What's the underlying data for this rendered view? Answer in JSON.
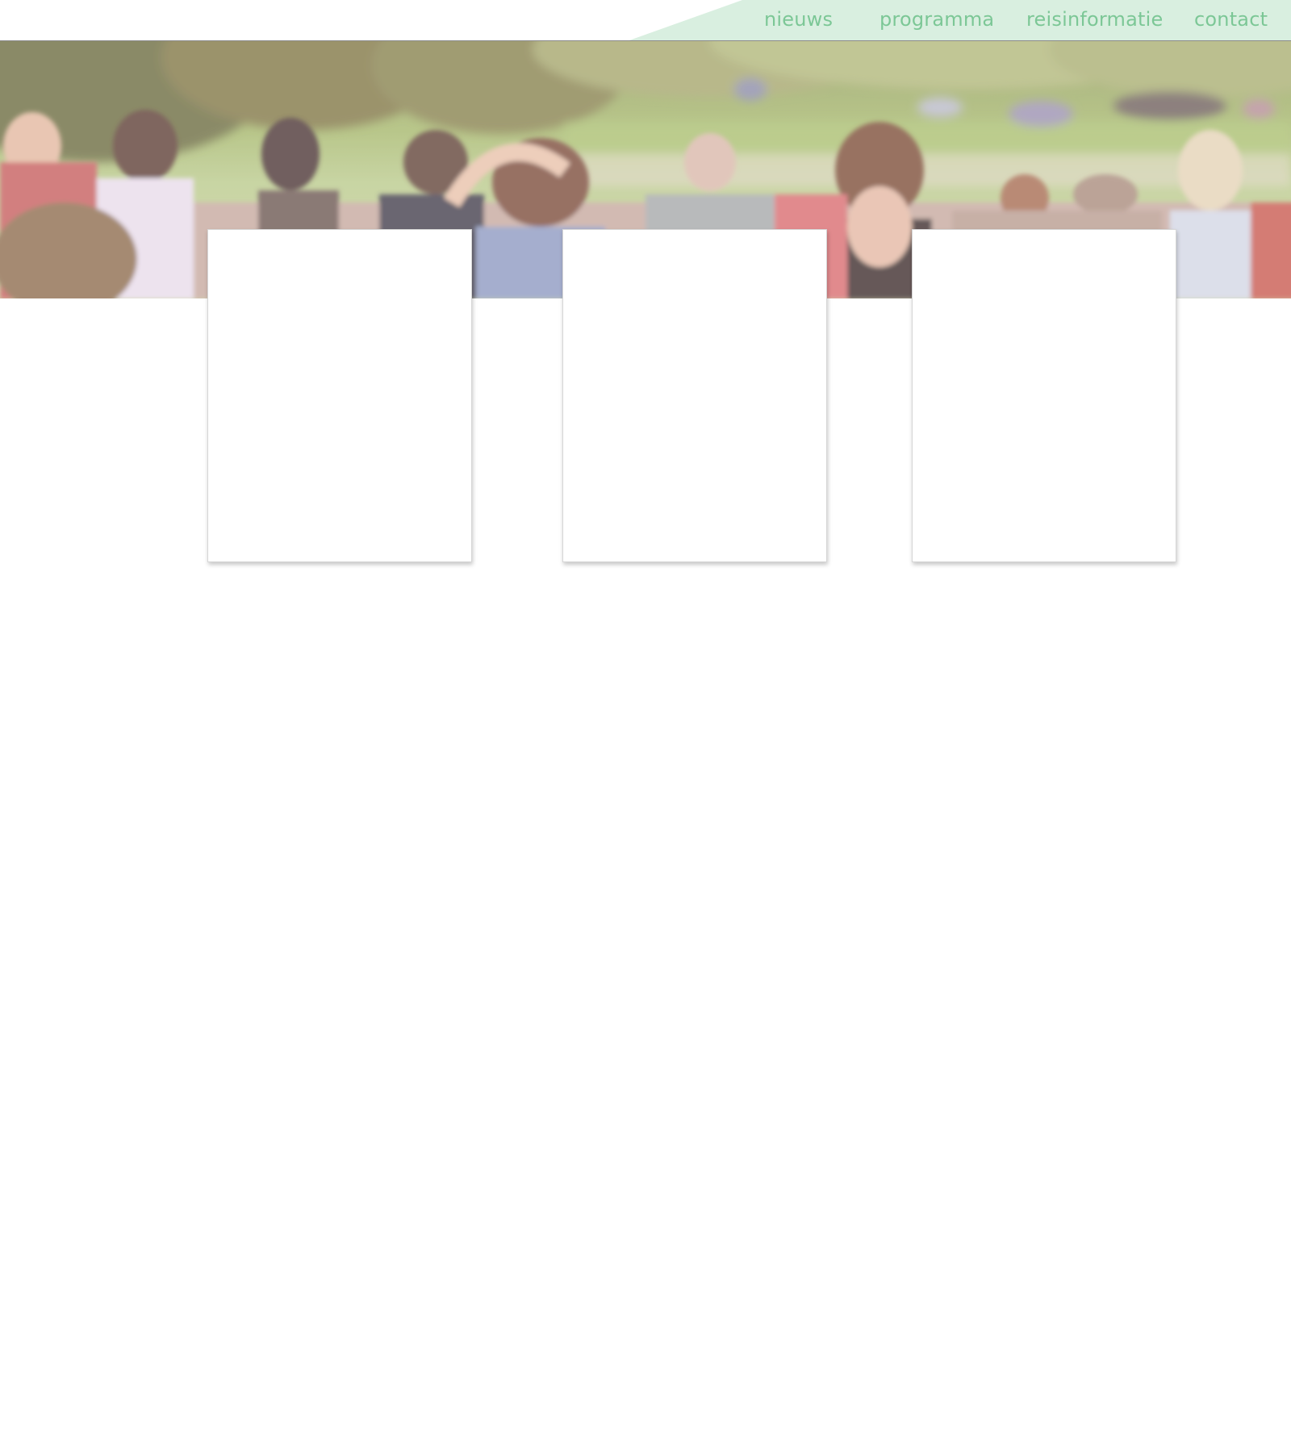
{
  "nav": {
    "items": [
      {
        "label": "nieuws"
      },
      {
        "label": "programma"
      },
      {
        "label": "reisinformatie"
      },
      {
        "label": "contact"
      }
    ]
  },
  "colors": {
    "nav_background": "#d9efe0",
    "nav_text": "#7cc796",
    "page_background": "#ffffff",
    "card_background": "#ffffff"
  },
  "hero": {
    "image": "blurred-crowd-at-outdoor-festival-photo"
  },
  "cards": [
    {
      "id": "card-1"
    },
    {
      "id": "card-2"
    },
    {
      "id": "card-3"
    }
  ]
}
